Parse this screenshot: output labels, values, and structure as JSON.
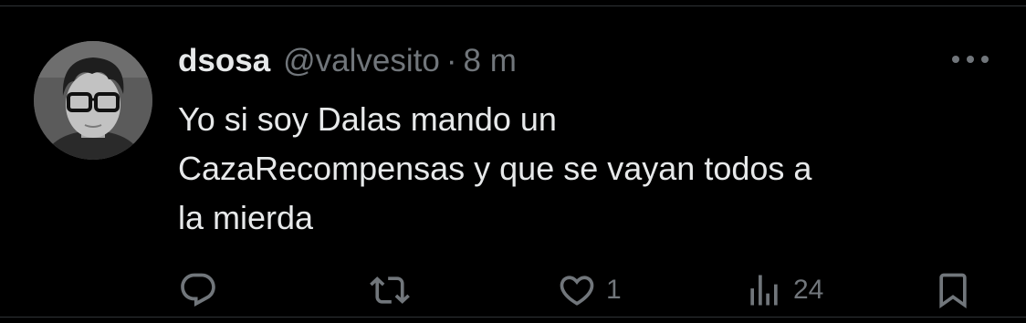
{
  "tweet": {
    "author": {
      "display_name": "dsosa",
      "handle": "@valvesito",
      "separator": "·",
      "time": "8 m"
    },
    "text_lines": [
      "Yo si soy Dalas mando un",
      "CazaRecompensas y que se vayan todos a",
      "la mierda"
    ],
    "actions": {
      "reply": {
        "icon": "reply-icon"
      },
      "retweet": {
        "icon": "retweet-icon"
      },
      "like": {
        "icon": "heart-icon",
        "count": "1"
      },
      "views": {
        "icon": "views-icon",
        "count": "24"
      },
      "bookmark": {
        "icon": "bookmark-icon"
      }
    },
    "more": {
      "icon": "more-icon"
    }
  },
  "colors": {
    "background": "#000000",
    "primary_text": "#e7e9ea",
    "secondary_text": "#71767b",
    "divider": "#2f3336"
  }
}
